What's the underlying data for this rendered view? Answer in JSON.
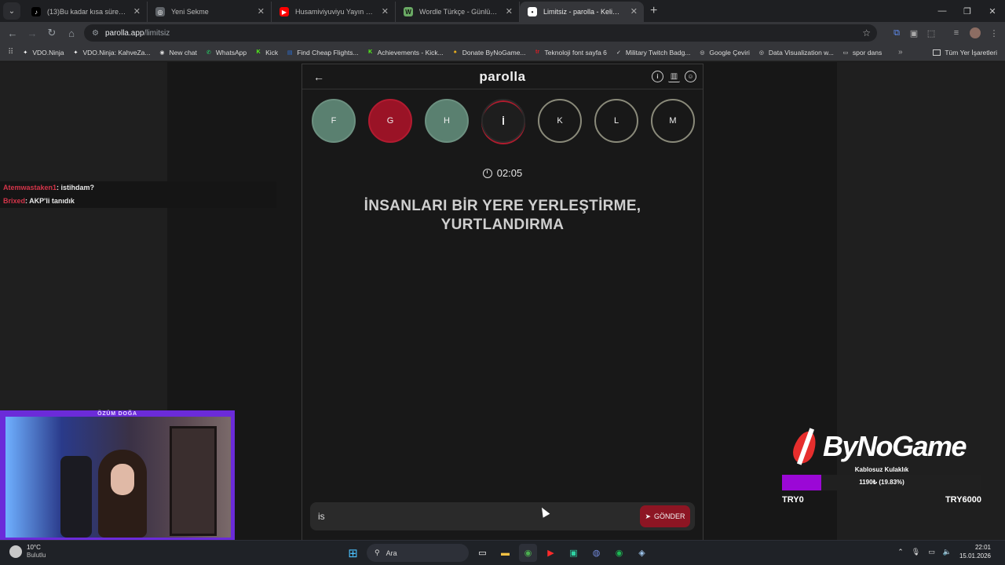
{
  "browser": {
    "tabs": [
      {
        "label": "(13)Bu kadar kısa sürede kendi",
        "favicon_color": "#000000",
        "favicon_text": "♪",
        "active": false
      },
      {
        "label": "Yeni Sekme",
        "favicon_color": "#5f6368",
        "favicon_text": "◎",
        "active": false
      },
      {
        "label": "Husamiviyuviyu Yayın Edit 21 Y",
        "favicon_color": "#ff0000",
        "favicon_text": "▶",
        "active": false
      },
      {
        "label": "Wordle Türkçe - Günlük Kelime",
        "favicon_color": "#6aaa64",
        "favicon_text": "W",
        "active": false
      },
      {
        "label": "Limitsiz - parolla - Kelime oyun",
        "favicon_color": "#ffffff",
        "favicon_text": "•",
        "active": true
      }
    ],
    "new_tab_icon": "+",
    "url_host": "parolla.app",
    "url_path": "/limitsiz",
    "bookmarks": [
      {
        "label": "VDO.Ninja",
        "icon_color": "#ffffff",
        "icon_text": "✦"
      },
      {
        "label": "VDO.Ninja: KahveZa...",
        "icon_color": "#ffffff",
        "icon_text": "✦"
      },
      {
        "label": "New chat",
        "icon_color": "#dddddd",
        "icon_text": "◉"
      },
      {
        "label": "WhatsApp",
        "icon_color": "#25d366",
        "icon_text": "✆"
      },
      {
        "label": "Kick",
        "icon_color": "#53fc18",
        "icon_text": "K"
      },
      {
        "label": "Find Cheap Flights...",
        "icon_color": "#2b6fd6",
        "icon_text": "▤"
      },
      {
        "label": "Achievements - Kick...",
        "icon_color": "#53fc18",
        "icon_text": "K"
      },
      {
        "label": "Donate ByNoGame...",
        "icon_color": "#f2b41c",
        "icon_text": "♠"
      },
      {
        "label": "Teknoloji font sayfa 6",
        "icon_color": "#d41f26",
        "icon_text": "tr"
      },
      {
        "label": "Military Twitch Badg...",
        "icon_color": "#dddddd",
        "icon_text": "✓"
      },
      {
        "label": "Google Çeviri",
        "icon_color": "#dddddd",
        "icon_text": "◎"
      },
      {
        "label": "Data Visualization w...",
        "icon_color": "#dddddd",
        "icon_text": "◎"
      },
      {
        "label": "spor dans",
        "icon_color": "#dddddd",
        "icon_text": "▭"
      }
    ],
    "all_bookmarks_label": "Tüm Yer İşaretleri"
  },
  "game": {
    "logo": "parolla",
    "letters": [
      {
        "char": "F",
        "state": "correct"
      },
      {
        "char": "G",
        "state": "wrong"
      },
      {
        "char": "H",
        "state": "correct"
      },
      {
        "char": "İ",
        "state": "current"
      },
      {
        "char": "K",
        "state": "pending"
      },
      {
        "char": "L",
        "state": "pending"
      },
      {
        "char": "M",
        "state": "pending"
      }
    ],
    "timer": "02:05",
    "question_line1": "İNSANLARI BİR YERE YERLEŞTİRME,",
    "question_line2": "YURTLANDIRMA",
    "answer_value": "is",
    "send_label": "GÖNDER"
  },
  "chat": [
    {
      "user": "Atemwastaken1",
      "message": ": istihdam?"
    },
    {
      "user": "Brixed",
      "message": ": AKP'li tanıdık"
    }
  ],
  "webcam": {
    "title": "ÖZÜM DOĞA"
  },
  "sponsor": {
    "brand": "ByNoGame",
    "goal_title": "Kablosuz Kulaklık",
    "goal_percent_label": "1190₺ (19.83%)",
    "goal_fraction": 0.1983,
    "goal_min": "TRY0",
    "goal_max": "TRY6000",
    "fill_color": "#9b08d6"
  },
  "taskbar": {
    "weather_temp": "10°C",
    "weather_desc": "Bulutlu",
    "search_label": "Ara",
    "time": "22:01",
    "date": "15.01.2026"
  }
}
